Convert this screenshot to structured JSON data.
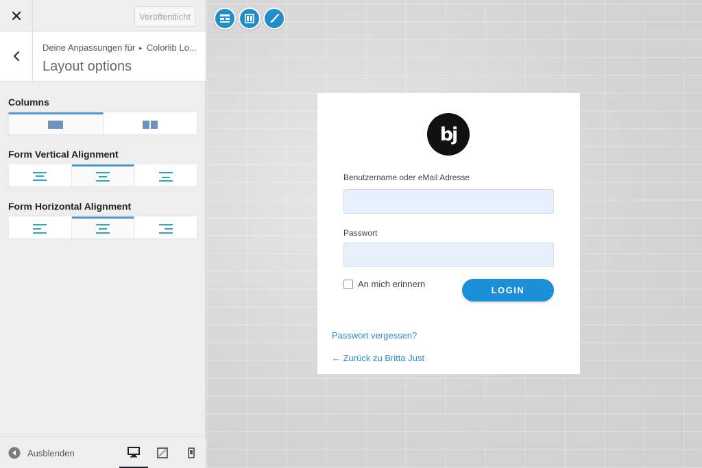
{
  "sidebar": {
    "publish_label": "Veröffentlicht",
    "breadcrumb": {
      "parent": "Deine Anpassungen für",
      "current": "Colorlib Lo..."
    },
    "section_title": "Layout options",
    "controls": {
      "columns": {
        "label": "Columns",
        "selected": 0,
        "options": [
          "one-column-icon",
          "two-column-icon"
        ]
      },
      "vertical": {
        "label": "Form Vertical Alignment",
        "selected": 1,
        "options": [
          "align-top-icon",
          "align-middle-icon",
          "align-bottom-icon"
        ]
      },
      "horizontal": {
        "label": "Form Horizontal Alignment",
        "selected": 1,
        "options": [
          "align-left-icon",
          "align-center-icon",
          "align-right-icon"
        ]
      }
    },
    "footer": {
      "collapse_label": "Ausblenden",
      "devices": [
        "desktop-icon",
        "tablet-icon",
        "mobile-icon"
      ],
      "active_device": "desktop"
    }
  },
  "preview": {
    "tools": [
      "layout-icon",
      "columns-icon",
      "brush-icon"
    ],
    "login": {
      "logo_text": "bj",
      "username_label": "Benutzername oder eMail Adresse",
      "username_value": "",
      "password_label": "Passwort",
      "password_value": "",
      "remember_label": "An mich erinnern",
      "login_label": "LOGIN",
      "lost_password": "Passwort vergessen?",
      "back_link": "← Zurück zu Britta Just"
    }
  },
  "colors": {
    "accent": "#4f94d4",
    "tool_blue": "#1f8ec9",
    "login_button": "#1b8fd8",
    "link": "#2b8cd6",
    "input_bg": "#e8effc"
  }
}
